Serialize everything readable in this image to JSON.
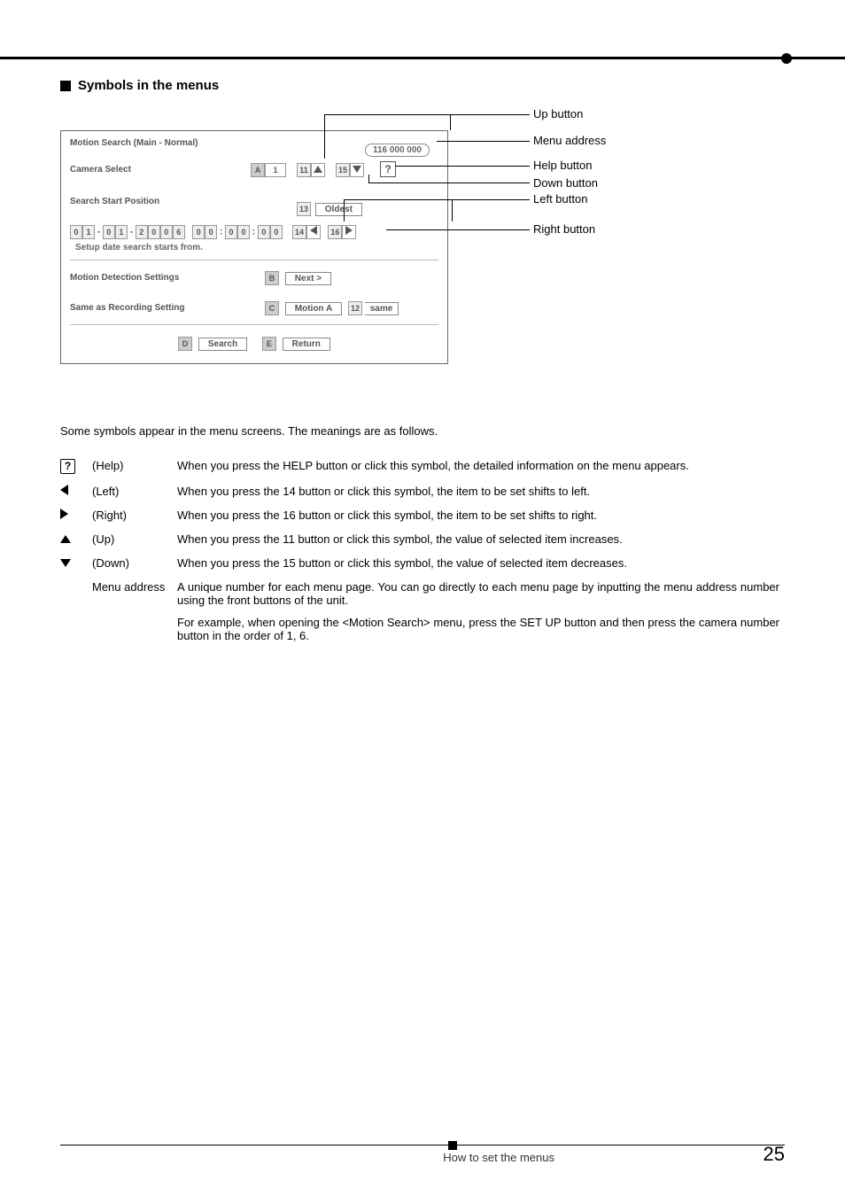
{
  "section_title": "Symbols in the menus",
  "diagram": {
    "menu_title": "Motion Search (Main - Normal)",
    "menu_address": "116 000 000",
    "camera_select_label": "Camera Select",
    "camera_select_letter": "A",
    "camera_select_value": "1",
    "up_btn_num": "11",
    "down_btn_num": "15",
    "help_glyph": "?",
    "search_start_label": "Search Start Position",
    "oldest_num": "13",
    "oldest_label": "Oldest",
    "date_dd": [
      "0",
      "1"
    ],
    "date_mm": [
      "0",
      "1"
    ],
    "date_yyyy": [
      "2",
      "0",
      "0",
      "6"
    ],
    "date_hh": [
      "0",
      "0"
    ],
    "date_min": [
      "0",
      "0"
    ],
    "date_sec": [
      "0",
      "0"
    ],
    "left_num": "14",
    "right_num": "16",
    "date_hint": "Setup date search starts from.",
    "motion_label": "Motion Detection Settings",
    "motion_letter": "B",
    "motion_btn": "Next >",
    "same_label": "Same as Recording Setting",
    "same_letter": "C",
    "same_btn": "Motion A",
    "same_num": "12",
    "same_val": "same",
    "search_letter": "D",
    "search_btn": "Search",
    "return_letter": "E",
    "return_btn": "Return",
    "labels": {
      "up": "Up button",
      "menu_address": "Menu address",
      "help": "Help button",
      "down": "Down button",
      "left": "Left button",
      "right": "Right button"
    }
  },
  "intro": "Some symbols appear in the menu screens. The meanings are as follows.",
  "defs": {
    "help_glyph": "?",
    "help_name": "(Help)",
    "help_desc": "When you press the HELP button or click this symbol, the detailed information on the menu appears.",
    "left_name": "(Left)",
    "left_desc": "When you press the 14 button or click this symbol, the item to be set shifts to left.",
    "right_name": "(Right)",
    "right_desc": "When you press the 16 button or click this symbol, the item to be set shifts to right.",
    "up_name": "(Up)",
    "up_desc": "When you press the 11 button or click this symbol, the value of selected item increases.",
    "down_name": "(Down)",
    "down_desc": "When you press the 15 button or click this symbol, the value of selected item decreases.",
    "addr_name": "Menu address",
    "addr_desc": "A unique number for each menu page. You can go directly to each menu page by inputting the menu address number using the front buttons of the unit.",
    "addr_desc2": "For example, when opening the <Motion Search> menu, press the SET UP button and then press the camera number button in the order of 1, 6."
  },
  "footer": {
    "text": "How to set the menus",
    "page": "25"
  }
}
